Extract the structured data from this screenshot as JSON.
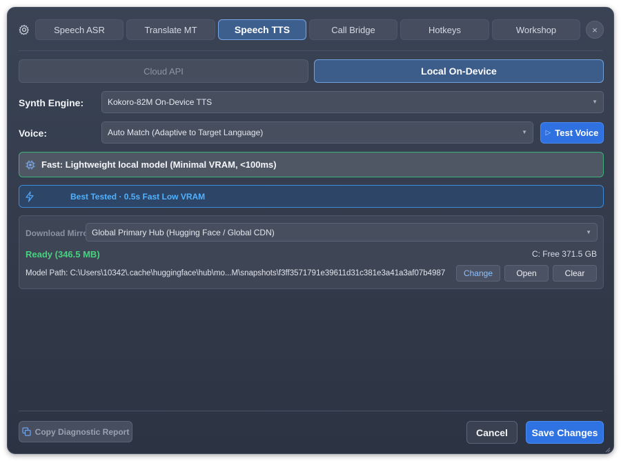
{
  "tabs": [
    {
      "label": "Speech ASR"
    },
    {
      "label": "Translate MT"
    },
    {
      "label": "Speech TTS"
    },
    {
      "label": "Call Bridge"
    },
    {
      "label": "Hotkeys"
    },
    {
      "label": "Workshop"
    }
  ],
  "active_tab": "Speech TTS",
  "close_label": "×",
  "mode": {
    "cloud": "Cloud API",
    "local": "Local On-Device",
    "selected": "Local On-Device"
  },
  "engine": {
    "label": "Synth Engine:",
    "value": "Kokoro-82M On-Device TTS"
  },
  "voice": {
    "label": "Voice:",
    "value": "Auto Match (Adaptive to Target Language)",
    "test_label": "Test Voice"
  },
  "banners": {
    "fast": "Fast: Lightweight local model (Minimal VRAM, <100ms)",
    "tested": "Best Tested · 0.5s Fast Low VRAM"
  },
  "model": {
    "mirror_label": "Download Mirror",
    "mirror_value": "Global Primary Hub (Hugging Face / Global CDN)",
    "status": "Ready (346.5 MB)",
    "free_space": "C: Free 371.5 GB",
    "path": "Model Path: C:\\Users\\10342\\.cache\\huggingface\\hub\\mo...M\\snapshots\\f3ff3571791e39611d31c381e3a41a3af07b4987",
    "change_label": "Change",
    "open_label": "Open",
    "clear_label": "Clear"
  },
  "footer": {
    "copy_label": "Copy Diagnostic Report",
    "cancel_label": "Cancel",
    "save_label": "Save Changes"
  },
  "colors": {
    "accent": "#2f72e2",
    "active_tab": "#3d5f8e",
    "ready": "#46d27f",
    "banner_border_green": "#3db37a",
    "banner_text_blue": "#4fb1ff"
  }
}
